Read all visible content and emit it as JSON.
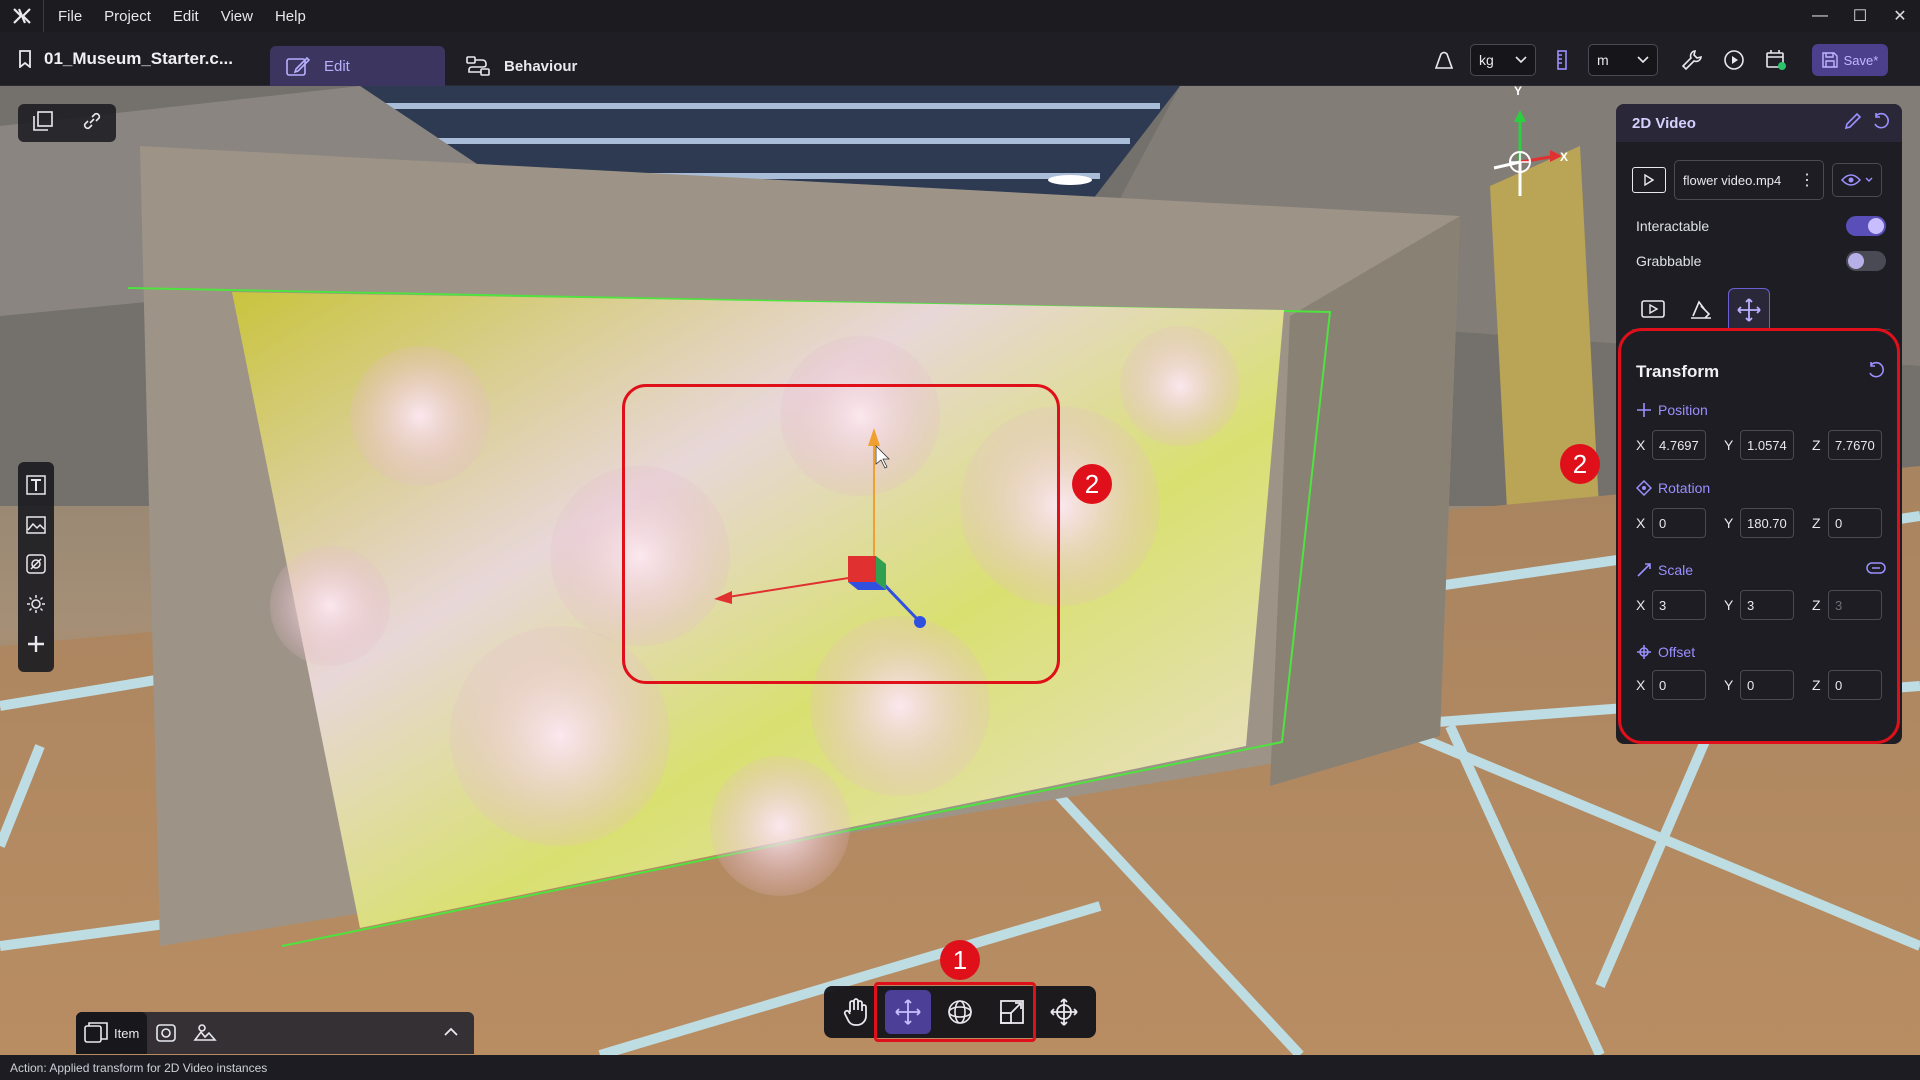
{
  "menubar": {
    "items": [
      "File",
      "Project",
      "Edit",
      "View",
      "Help"
    ]
  },
  "toolbar": {
    "project_name": "01_Museum_Starter.c...",
    "tabs": [
      {
        "label": "Edit",
        "active": true
      },
      {
        "label": "Behaviour",
        "active": false
      }
    ],
    "mass_unit": "kg",
    "length_unit": "m",
    "save_label": "Save*"
  },
  "viewport": {
    "axis_labels": {
      "y": "Y",
      "x": "X"
    }
  },
  "bottom_left": {
    "item_label": "Item"
  },
  "transform_tools": {
    "tools": [
      "hand-icon",
      "move-icon",
      "rotate-icon",
      "scale-icon",
      "universal-icon"
    ],
    "active_index": 1
  },
  "panel": {
    "title": "2D Video",
    "file_name": "flower video.mp4",
    "interactable_label": "Interactable",
    "interactable_on": true,
    "grabbable_label": "Grabbable",
    "grabbable_on": false,
    "transform": {
      "title": "Transform",
      "position_label": "Position",
      "position": {
        "x": "4.7697",
        "y": "1.0574",
        "z": "7.7670"
      },
      "rotation_label": "Rotation",
      "rotation": {
        "x": "0",
        "y": "180.70",
        "z": "0"
      },
      "scale_label": "Scale",
      "scale": {
        "x": "3",
        "y": "3",
        "z": "3"
      },
      "offset_label": "Offset",
      "offset": {
        "x": "0",
        "y": "0",
        "z": "0"
      },
      "axis": {
        "x": "X",
        "y": "Y",
        "z": "Z"
      }
    }
  },
  "annotations": {
    "marker_1": "1",
    "marker_2": "2",
    "color": "#e0101a"
  },
  "status": {
    "text": "Action: Applied transform for 2D Video instances"
  },
  "colors": {
    "accent": "#4b3f98",
    "accent_text": "#9a90ff",
    "panel_bg": "#1d1d23"
  }
}
